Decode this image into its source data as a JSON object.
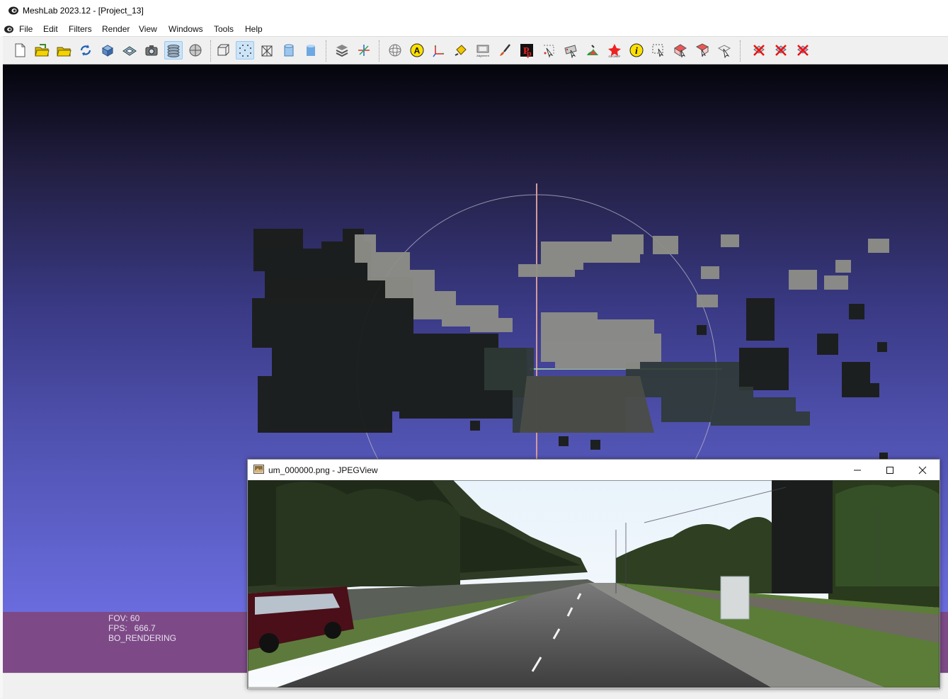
{
  "window": {
    "title": "MeshLab 2023.12 - [Project_13]"
  },
  "menu": {
    "items": [
      "File",
      "Edit",
      "Filters",
      "Render",
      "View",
      "Windows",
      "Tools",
      "Help"
    ]
  },
  "toolbar": {
    "buttons": [
      {
        "name": "new-project-icon"
      },
      {
        "name": "open-project-icon"
      },
      {
        "name": "import-mesh-icon"
      },
      {
        "name": "reload-icon"
      },
      {
        "name": "export-mesh-icon"
      },
      {
        "name": "save-snapshot-icon"
      },
      {
        "name": "camera-icon"
      },
      {
        "name": "layers-icon"
      },
      {
        "name": "raster-icon"
      },
      {
        "name": "bounding-box-icon"
      },
      {
        "name": "points-icon"
      },
      {
        "name": "wireframe-icon"
      },
      {
        "name": "flat-icon"
      },
      {
        "name": "smooth-icon"
      },
      {
        "name": "layer-stack-icon"
      },
      {
        "name": "axis-gizmo-icon"
      },
      {
        "name": "trackball-icon"
      },
      {
        "name": "annotation-a-icon"
      },
      {
        "name": "axes-icon"
      },
      {
        "name": "paint-bucket-icon"
      },
      {
        "name": "align-icon"
      },
      {
        "name": "brush-icon"
      },
      {
        "name": "pickpoints-icon"
      },
      {
        "name": "select-vertices-icon"
      },
      {
        "name": "select-connected-icon"
      },
      {
        "name": "paint-mesh-icon"
      },
      {
        "name": "georef-icon"
      },
      {
        "name": "info-icon"
      },
      {
        "name": "select-rect-icon"
      },
      {
        "name": "select-faces-icon"
      },
      {
        "name": "select-region-icon"
      },
      {
        "name": "select-z-icon"
      },
      {
        "name": "delete-vertices-icon"
      },
      {
        "name": "delete-faces-icon"
      },
      {
        "name": "delete-all-icon"
      }
    ],
    "align_label": "Alignment",
    "georef_label": "GEOREF",
    "annotation_letter": "A",
    "info_letter": "i"
  },
  "hud": {
    "fov": "FOV: 60",
    "fps": "FPS:   666.7",
    "mode": "BO_RENDERING"
  },
  "jpegview": {
    "title": "um_000000.png - JPEGView"
  },
  "colors": {
    "viewport_top": "#04040c",
    "viewport_bottom": "#6a6cde",
    "hud_bg": "#7d4a87",
    "active_button": "#cce4f7"
  }
}
